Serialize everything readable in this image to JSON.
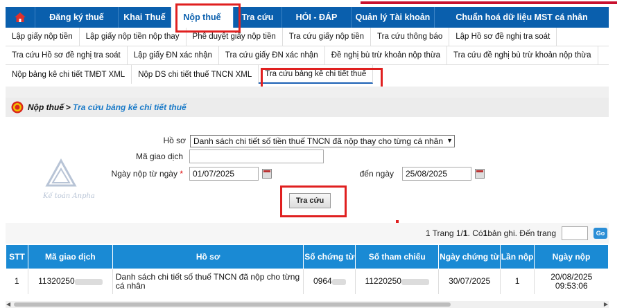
{
  "nav": {
    "items": [
      "Đăng ký thuế",
      "Khai Thuế",
      "Nộp thuế",
      "Tra cứu",
      "HỎI - ĐÁP",
      "Quản lý Tài khoản",
      "Chuẩn hoá dữ liệu MST cá nhân"
    ],
    "active": "Nộp thuế",
    "home_icon": "home-icon"
  },
  "subnav": {
    "row1": [
      "Lập giấy nộp tiền",
      "Lập giấy nộp tiền nộp thay",
      "Phê duyệt giấy nộp tiền",
      "Tra cứu giấy nộp tiền",
      "Tra cứu thông báo",
      "Lập Hồ sơ đề nghị tra soát"
    ],
    "row2": [
      "Tra cứu Hồ sơ đề nghị tra soát",
      "Lập giấy ĐN xác nhận",
      "Tra cứu giấy ĐN xác nhận",
      "Đề nghị bù trừ khoản nộp thừa",
      "Tra cứu đề nghị bù trừ khoản nộp thừa"
    ],
    "row3": [
      "Nộp bảng kê chi tiết TMĐT XML",
      "Nộp DS chi tiết thuế TNCN XML",
      "Tra cứu bảng kê chi tiết thuế"
    ]
  },
  "breadcrumb": {
    "part1": "Nộp thuế",
    "sep": ">",
    "part2": "Tra cứu bảng kê chi tiết thuế"
  },
  "form": {
    "ho_so_label": "Hồ sơ",
    "ho_so_value": "Danh sách chi tiết số tiền thuế TNCN đã nộp thay cho từng cá nhân",
    "ma_gd_label": "Mã giao dịch",
    "ma_gd_value": "",
    "from_label": "Ngày nộp từ ngày",
    "required_mark": "*",
    "from_value": "01/07/2025",
    "to_label": "đến ngày",
    "to_value": "25/08/2025",
    "search_button": "Tra cứu"
  },
  "pager": {
    "pre": "1 Trang 1/",
    "total_pages": "1",
    "mid": ". Có ",
    "count": "1",
    "post": " bản ghi. Đến trang",
    "go": "Go"
  },
  "table": {
    "headers": [
      "STT",
      "Mã giao dịch",
      "Hồ sơ",
      "Số chứng từ",
      "Số tham chiếu",
      "Ngày chứng từ",
      "Lần nộp",
      "Ngày nộp"
    ],
    "rows": [
      {
        "stt": "1",
        "ma_gd": "11320250",
        "ho_so": "Danh sách chi tiết số thuế TNCN đã nộp cho từng cá nhân",
        "so_ct": "0964",
        "so_tc": "11220250",
        "ngay_ct": "30/07/2025",
        "lan_nop": "1",
        "ngay_nop_date": "20/08/2025",
        "ngay_nop_time": "09:53:06"
      }
    ]
  },
  "colors": {
    "nav_bg": "#0a5fad",
    "header_bg": "#1a8ad4",
    "highlight": "#e02020"
  }
}
